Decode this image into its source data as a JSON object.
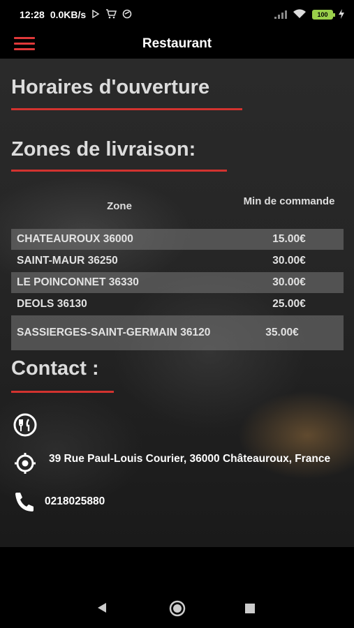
{
  "status_bar": {
    "time": "12:28",
    "speed": "0.0KB/s",
    "battery": "100",
    "icons": [
      "play-icon",
      "cart-icon",
      "target-icon",
      "signal-icon",
      "wifi-icon",
      "battery-icon",
      "charging-icon"
    ]
  },
  "app_bar": {
    "title": "Restaurant",
    "menu_icon": "hamburger-icon",
    "accent_color": "#e0393a"
  },
  "sections": {
    "hours_title": "Horaires d'ouverture",
    "zones_title": "Zones de livraison:",
    "contact_title": "Contact :"
  },
  "zones_table": {
    "headers": {
      "zone": "Zone",
      "min": "Min de commande"
    },
    "rows": [
      {
        "zone": "CHATEAUROUX 36000",
        "min": "15.00€"
      },
      {
        "zone": "SAINT-MAUR 36250",
        "min": "30.00€"
      },
      {
        "zone": "LE POINCONNET 36330",
        "min": "30.00€"
      },
      {
        "zone": "DEOLS 36130",
        "min": "25.00€"
      },
      {
        "zone": "SASSIERGES-SAINT-GERMAIN 36120",
        "min": "35.00€"
      }
    ]
  },
  "contact": {
    "address": "39 Rue Paul-Louis Courier, 36000 Châteauroux, France",
    "phone": "0218025880",
    "icons": [
      "restaurant-icon",
      "location-icon",
      "phone-icon"
    ]
  },
  "nav_bar": {
    "icons": [
      "back-icon",
      "home-icon",
      "recents-icon"
    ]
  }
}
